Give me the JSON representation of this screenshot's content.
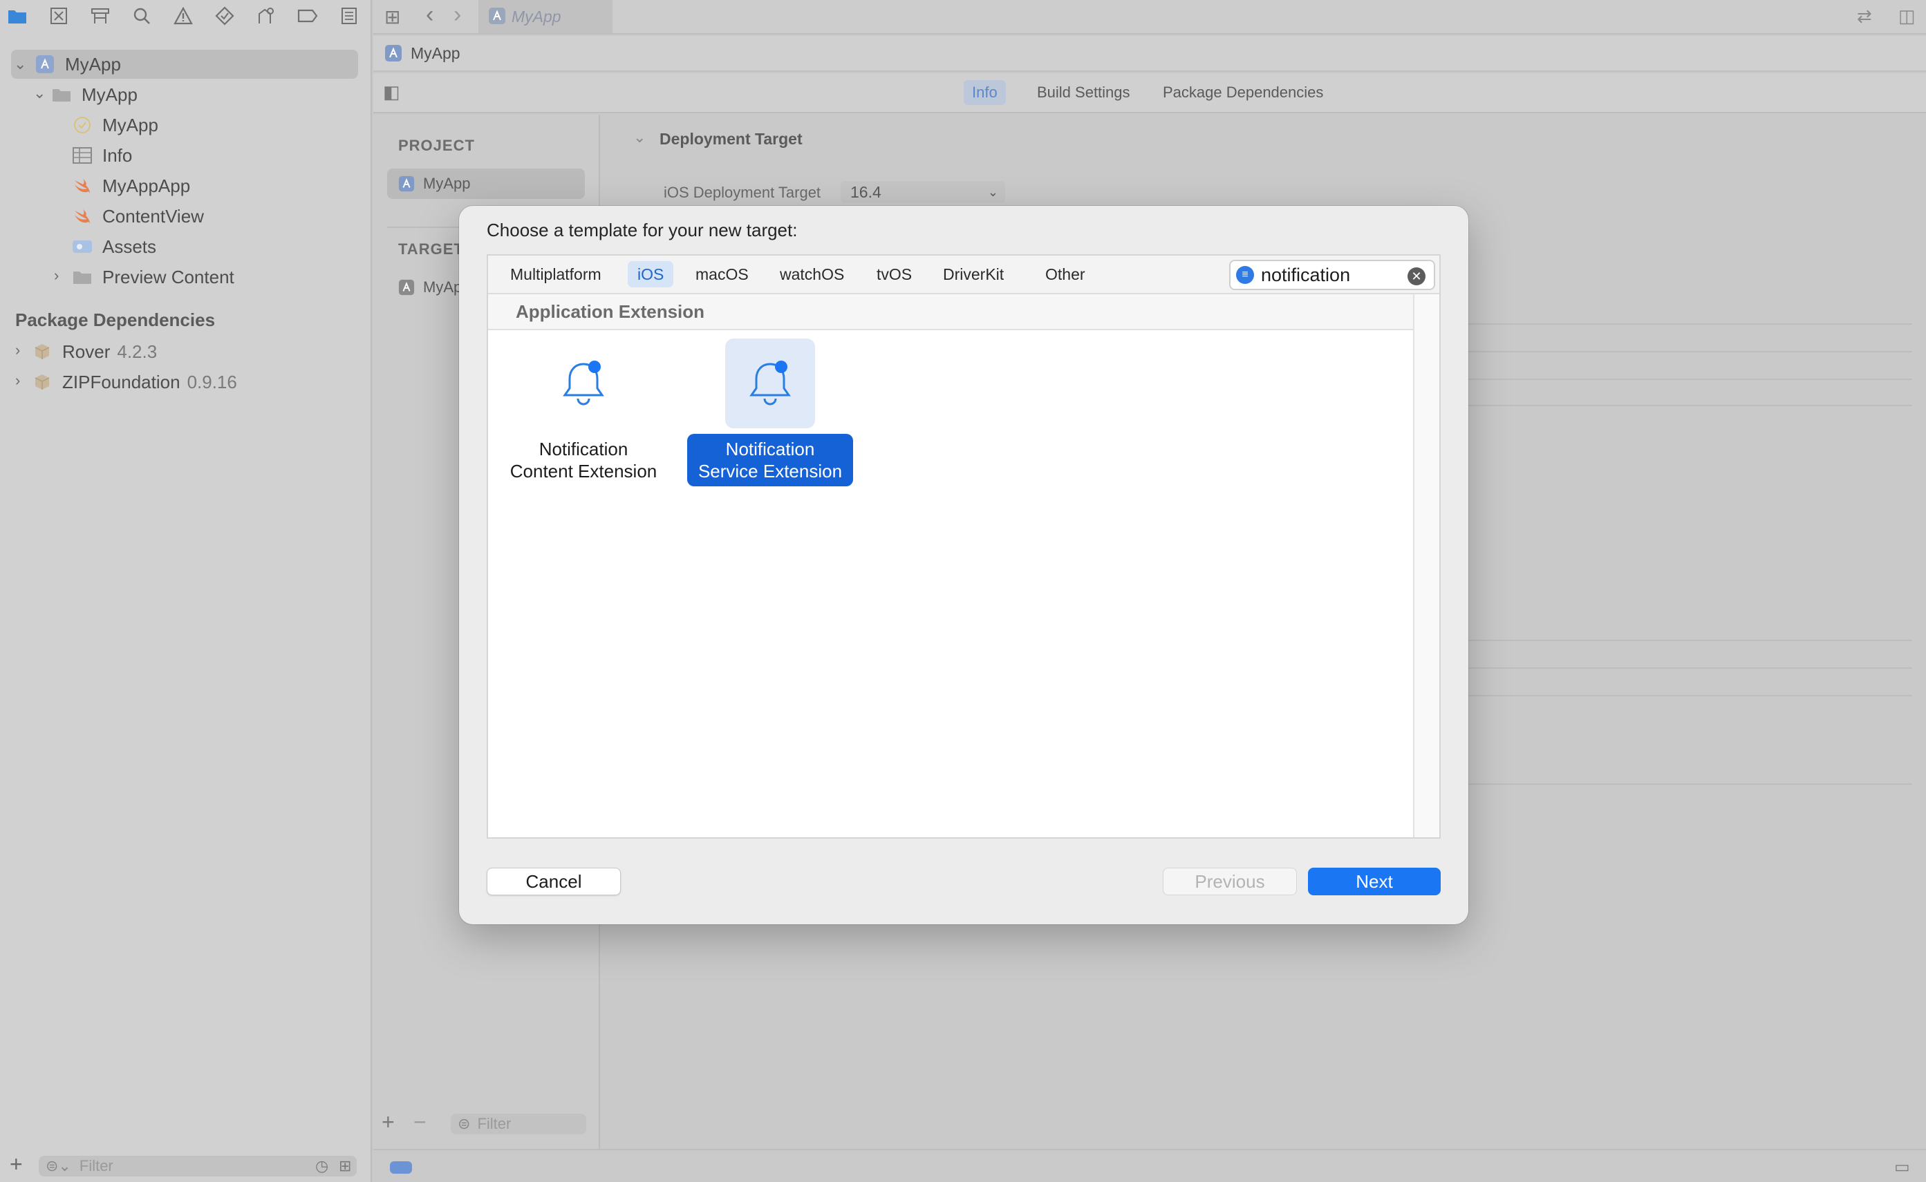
{
  "active_file_tab": "MyApp",
  "navigator": {
    "tree": [
      {
        "label": "MyApp",
        "icon": "app-project-icon"
      },
      {
        "label": "MyApp",
        "icon": "folder-icon"
      },
      {
        "label": "MyApp",
        "icon": "app-entitlements-icon"
      },
      {
        "label": "Info",
        "icon": "table-icon"
      },
      {
        "label": "MyAppApp",
        "icon": "swift-file-icon"
      },
      {
        "label": "ContentView",
        "icon": "swift-file-icon"
      },
      {
        "label": "Assets",
        "icon": "asset-catalog-icon"
      },
      {
        "label": "Preview Content",
        "icon": "folder-icon"
      }
    ],
    "package_header": "Package Dependencies",
    "packages": [
      {
        "name": "Rover",
        "version": "4.2.3"
      },
      {
        "name": "ZIPFoundation",
        "version": "0.9.16"
      }
    ],
    "filter_placeholder": "Filter"
  },
  "editor": {
    "jump_bar": "MyApp",
    "tabs": [
      "Info",
      "Build Settings",
      "Package Dependencies"
    ],
    "active_tab": "Info",
    "project_header": "PROJECT",
    "project_item": "MyApp",
    "targets_header": "TARGET",
    "target_item": "MyAp",
    "filter_placeholder": "Filter",
    "section_title": "Deployment Target",
    "deployment_label": "iOS Deployment Target",
    "deployment_value": "16.4"
  },
  "dialog": {
    "title": "Choose a template for your new target:",
    "platforms": [
      "Multiplatform",
      "iOS",
      "macOS",
      "watchOS",
      "tvOS",
      "DriverKit",
      "Other"
    ],
    "active_platform": "iOS",
    "search_value": "notification",
    "section": "Application Extension",
    "templates": [
      {
        "line1": "Notification",
        "line2": "Content Extension",
        "selected": false
      },
      {
        "line1": "Notification",
        "line2": "Service Extension",
        "selected": true
      }
    ],
    "cancel_label": "Cancel",
    "previous_label": "Previous",
    "next_label": "Next"
  },
  "colors": {
    "accent": "#1a76f2",
    "selection": "#1562d6",
    "bell": "#2a7de1"
  }
}
